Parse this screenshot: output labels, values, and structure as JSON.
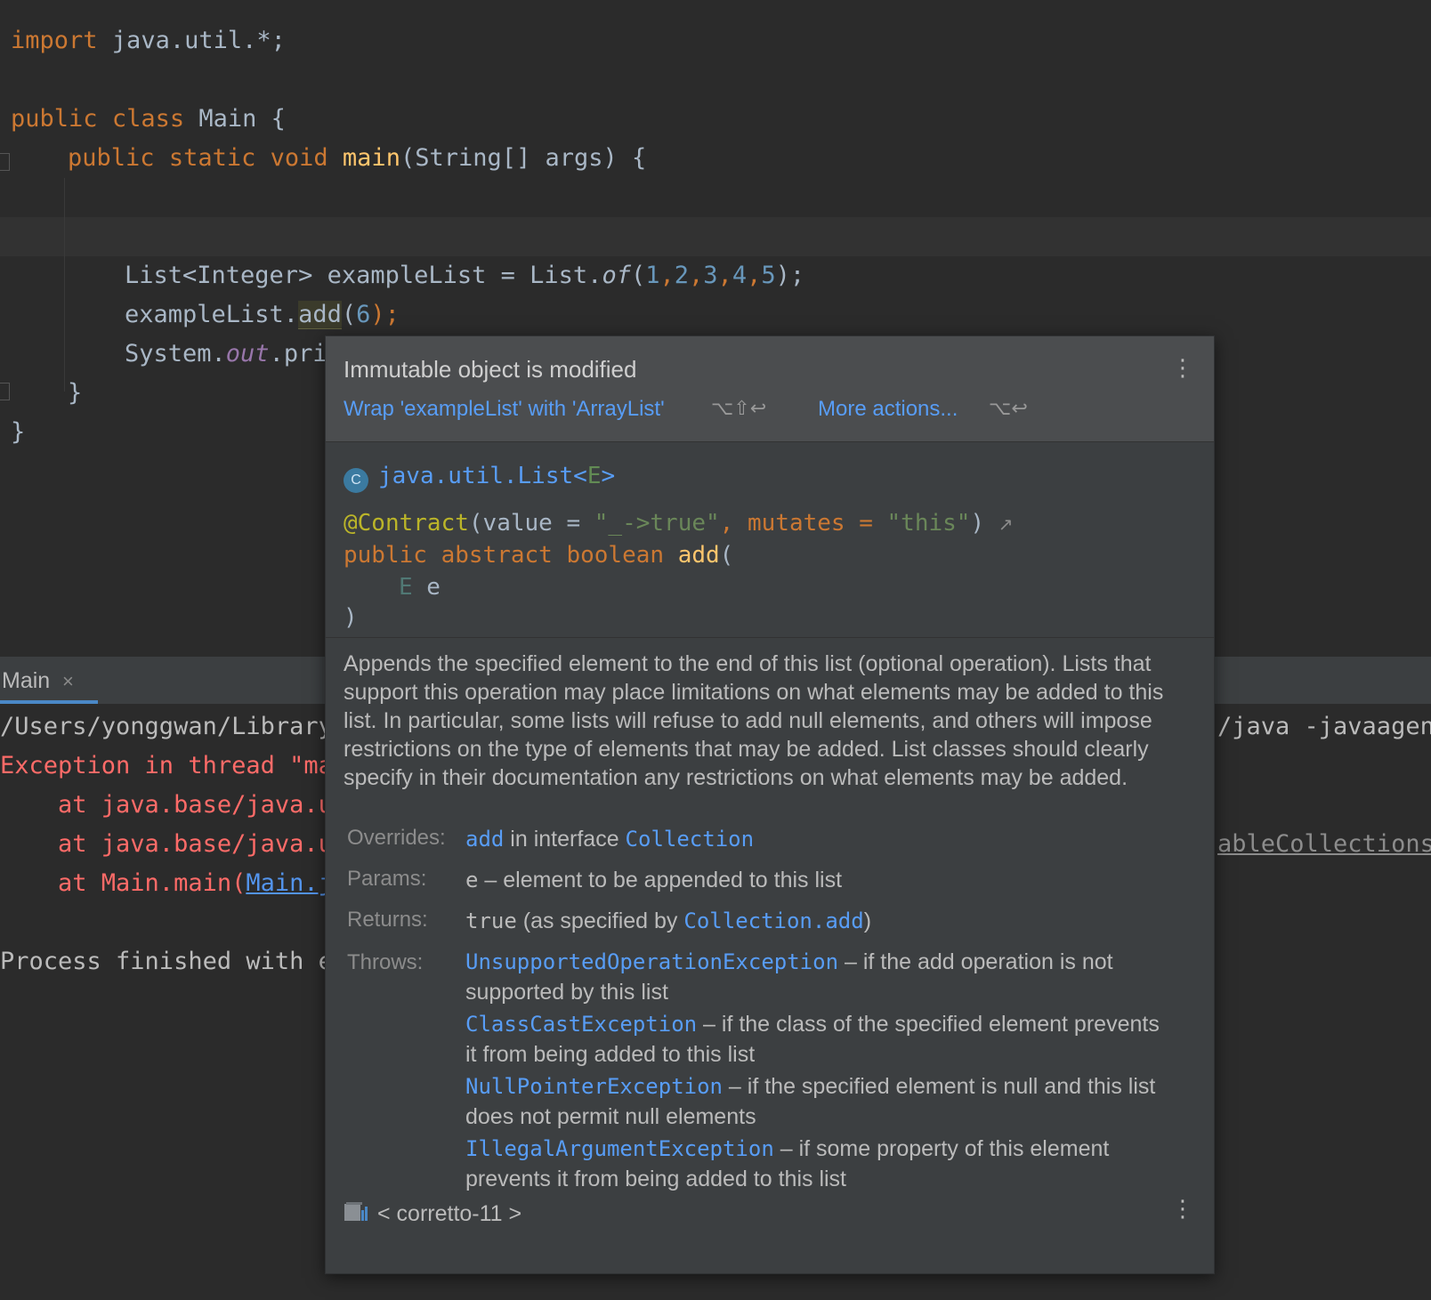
{
  "editor": {
    "line1": {
      "kw": "import",
      "rest": " java.util.*;"
    },
    "line3": {
      "kw1": "public",
      "kw2": "class",
      "name": " Main ",
      "brace": "{"
    },
    "line4": {
      "kw1": "public",
      "kw2": "static",
      "kw3": "void",
      "fn": "main",
      "rest": "(String[] args) {"
    },
    "line6": {
      "type": "List<Integer> exampleList = List.",
      "of": "of",
      "open": "(",
      "nums": [
        "1",
        "2",
        "3",
        "4",
        "5"
      ],
      "close": ");"
    },
    "line7": {
      "obj": "exampleList.",
      "method": "add",
      "open": "(",
      "arg": "6",
      "close": ");"
    },
    "line8": {
      "obj": "System.",
      "field": "out",
      "rest": ".pri"
    },
    "line9": "}",
    "line10": "}"
  },
  "run_panel": {
    "tab_label": "Main",
    "tab_close": "×",
    "lines": [
      {
        "left": "/Users/yonggwan/Library",
        "right": "/java -javaagent"
      },
      {
        "left": "Exception in thread \"ma"
      },
      {
        "left": "    at java.base/java.u"
      },
      {
        "left": "    at java.base/java.u",
        "right": "ableCollections."
      },
      {
        "prefix": "    at Main.main(",
        "link": "Main.j"
      },
      {
        "left": "Process finished with e"
      }
    ]
  },
  "popup": {
    "title": "Immutable object is modified",
    "menu_glyph": "⋮",
    "action1": "Wrap 'exampleList' with 'ArrayList'",
    "action1_shortcut": "⌥⇧↩",
    "action2": "More actions...",
    "action2_shortcut": "⌥↩",
    "class_badge": "C",
    "class_name": "java.util.List<",
    "class_generic": "E",
    "class_close": ">",
    "signature": {
      "annotation": "@Contract",
      "ann_open": "(value = ",
      "ann_value": "\"_->true\"",
      "ann_mid": ", mutates = ",
      "ann_mutates": "\"this\"",
      "ann_close": ")",
      "ann_arrow": "↗",
      "kw1": "public",
      "kw2": "abstract",
      "kw3": "boolean",
      "method": "add",
      "open": "(",
      "param_type": "E",
      "param_name": " e",
      "close": ")"
    },
    "description": "Appends the specified element to the end of this list (optional operation). Lists that support this operation may place limitations on what elements may be added to this list. In particular, some lists will refuse to add null elements, and others will impose restrictions on the type of elements that may be added. List classes should clearly specify in their documentation any restrictions on what elements may be added.",
    "overrides": {
      "label": "Overrides:",
      "method": "add",
      "middle": " in interface ",
      "iface": "Collection"
    },
    "params": {
      "label": "Params:",
      "name": "e",
      "text": " – element to be appended to this list"
    },
    "returns": {
      "label": "Returns:",
      "value": "true",
      "middle": " (as specified by ",
      "link": "Collection.add",
      "end": ")"
    },
    "throws": {
      "label": "Throws:",
      "items": [
        {
          "name": "UnsupportedOperationException",
          "text": " – if the add operation is not supported by this list"
        },
        {
          "name": "ClassCastException",
          "text": " – if the class of the specified element prevents it from being added to this list"
        },
        {
          "name": "NullPointerException",
          "text": " – if the specified element is null and this list does not permit null elements"
        },
        {
          "name": "IllegalArgumentException",
          "text": " – if some property of this element prevents it from being added to this list"
        }
      ]
    },
    "footer": "< corretto-11 >"
  }
}
